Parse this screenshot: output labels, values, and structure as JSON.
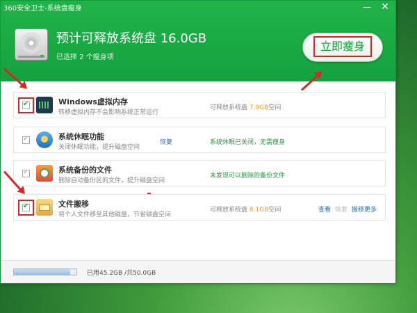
{
  "window": {
    "title": "360安全卫士-系统盘瘦身",
    "min_glyph": "—",
    "close_glyph": "✕"
  },
  "header": {
    "headline": "预计可释放系统盘 16.0GB",
    "subline": "已选择 2 个瘦身项",
    "slim_button": "立即瘦身"
  },
  "rows": [
    {
      "title": "Windows虚拟内存",
      "desc": "转移虚拟内存不会影响系统正常运行",
      "info_prefix": "可释放系统盘 ",
      "info_value": "7.9GB",
      "info_suffix": "空间",
      "checked": true,
      "icon": "memory-chip-icon"
    },
    {
      "title": "系统休眠功能",
      "desc": "关闭休眠功能，提升磁盘空间",
      "action": "恢复",
      "info": "系统休眠已关闭，无需瘦身",
      "checked": false,
      "icon": "hibernate-icon"
    },
    {
      "title": "系统备份的文件",
      "desc": "删除自动备份区的文件，提升磁盘空间",
      "info": "未发现可以删除的备份文件",
      "checked": false,
      "icon": "backup-icon"
    },
    {
      "title": "文件搬移",
      "desc": "将个人文件移至其他磁盘，节省磁盘空间",
      "info_prefix": "可释放系统盘 ",
      "info_value": "8.1GB",
      "info_suffix": "空间",
      "links": [
        "查看",
        "恢复",
        "搬移更多"
      ],
      "checked": true,
      "icon": "folder-move-icon"
    }
  ],
  "footer": {
    "usage_text": "已用45.2GB /共50.0GB",
    "used_fraction": 0.904
  },
  "colors": {
    "brand_green": "#18a03c",
    "highlight_red": "#d62424",
    "accent_orange": "#f39a1e",
    "link_blue": "#2a6fc1"
  }
}
